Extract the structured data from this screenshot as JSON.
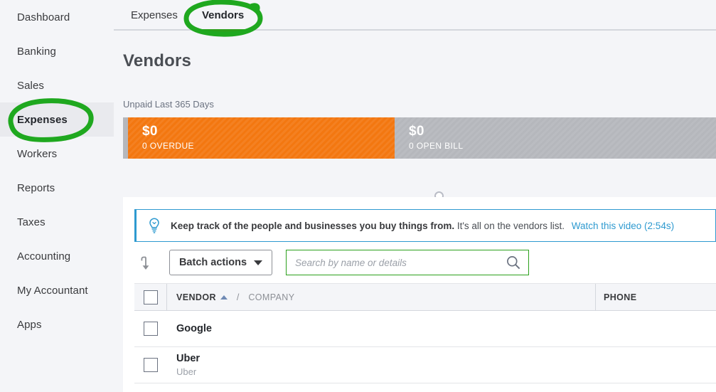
{
  "sidebar": {
    "items": [
      {
        "label": "Dashboard",
        "active": false
      },
      {
        "label": "Banking",
        "active": false
      },
      {
        "label": "Sales",
        "active": false
      },
      {
        "label": "Expenses",
        "active": true
      },
      {
        "label": "Workers",
        "active": false
      },
      {
        "label": "Reports",
        "active": false
      },
      {
        "label": "Taxes",
        "active": false
      },
      {
        "label": "Accounting",
        "active": false
      },
      {
        "label": "My Accountant",
        "active": false
      },
      {
        "label": "Apps",
        "active": false
      }
    ]
  },
  "tabs": [
    {
      "label": "Expenses",
      "active": false
    },
    {
      "label": "Vendors",
      "active": true
    }
  ],
  "page": {
    "title": "Vendors"
  },
  "moneybar": {
    "label": "Unpaid Last 365 Days",
    "segments": [
      {
        "amount": "$0",
        "caption": "0 OVERDUE",
        "color": "#f37710"
      },
      {
        "amount": "$0",
        "caption": "0 OPEN BILL",
        "color": "#b5b7bc"
      }
    ]
  },
  "banner": {
    "icon": "lightbulb-icon",
    "headline": "Keep track of the people and businesses you buy things from.",
    "subtext": "It's all on the vendors list.",
    "link": "Watch this video (2:54s)",
    "accent_color": "#2e9ad0"
  },
  "toolbar": {
    "import_icon": "arrow-down-hook-icon",
    "batch_actions_label": "Batch actions",
    "search": {
      "value": "",
      "placeholder": "Search by name or details",
      "icon": "search-icon",
      "focus_color": "#2ca01c"
    }
  },
  "table": {
    "columns": {
      "vendor": "VENDOR",
      "separator": "/",
      "company": "COMPANY",
      "phone": "PHONE"
    },
    "sort": {
      "column": "VENDOR",
      "direction": "asc"
    },
    "rows": [
      {
        "vendor": "Google",
        "company": "",
        "phone": ""
      },
      {
        "vendor": "Uber",
        "company": "Uber",
        "phone": ""
      }
    ]
  },
  "annotations": {
    "color": "#1fa81f",
    "marks": [
      {
        "target": "sidebar-item-expenses",
        "shape": "ellipse"
      },
      {
        "target": "tab-vendors",
        "shape": "ellipse"
      }
    ]
  }
}
